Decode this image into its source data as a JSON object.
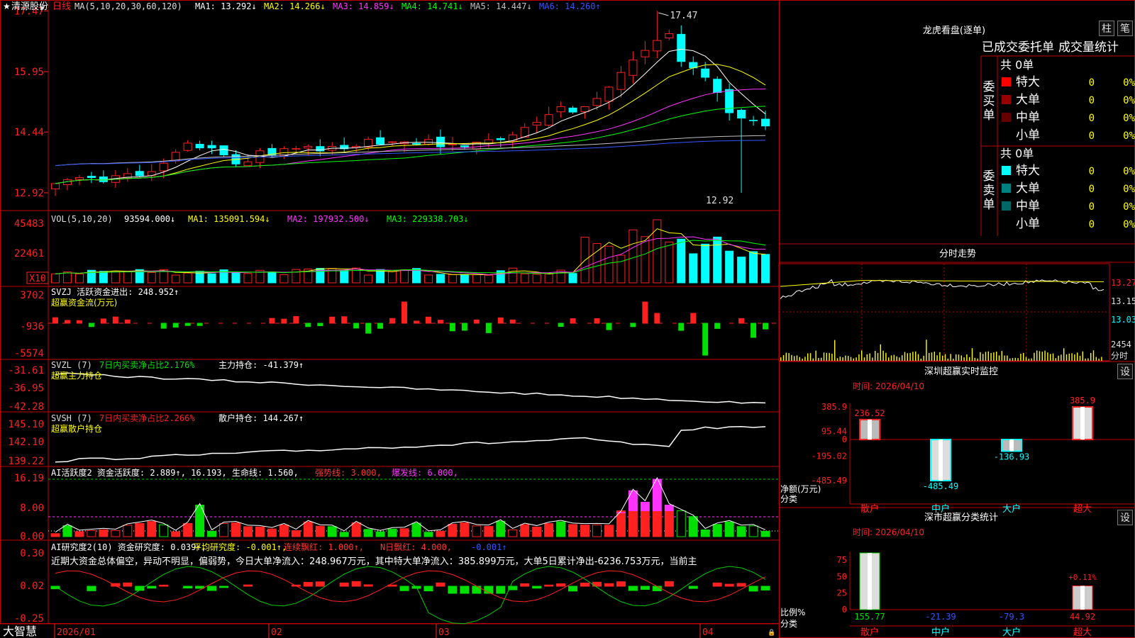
{
  "header": {
    "star": "★",
    "stock_name": "清源股份",
    "period": "日线",
    "ma_label": "MA(5,10,20,30,60,120)",
    "ma_values": [
      {
        "label": "MA1:",
        "value": "13.292",
        "arrow": "↓",
        "color": "#ffffff"
      },
      {
        "label": "MA2:",
        "value": "14.266",
        "arrow": "↓",
        "color": "#ffff00"
      },
      {
        "label": "MA3:",
        "value": "14.859",
        "arrow": "↓",
        "color": "#ff33ff"
      },
      {
        "label": "MA4:",
        "value": "14.741",
        "arrow": "↓",
        "color": "#00ff00"
      },
      {
        "label": "MA5:",
        "value": "14.447",
        "arrow": "↓",
        "color": "#c0c0c0"
      },
      {
        "label": "MA6:",
        "value": "14.260",
        "arrow": "↑",
        "color": "#3355ff"
      }
    ],
    "high_mark": "17.47",
    "low_mark": "12.92"
  },
  "price_axis": [
    "17.47",
    "15.95",
    "14.44",
    "12.92"
  ],
  "vol_panel": {
    "name": "VOL(5,10,20)",
    "value": "93594.000",
    "arrow": "↓",
    "ma": [
      {
        "label": "MA1:",
        "value": "135091.594",
        "arrow": "↓",
        "color": "#ffff00"
      },
      {
        "label": "MA2:",
        "value": "197932.500",
        "arrow": "↓",
        "color": "#ff33ff"
      },
      {
        "label": "MA3:",
        "value": "229338.703",
        "arrow": "↓",
        "color": "#00ff00"
      }
    ],
    "axis": [
      "45483",
      "22461"
    ],
    "unit": "X10"
  },
  "svzj_panel": {
    "name": "SVZJ",
    "label": "活跃资金进出:",
    "value": "248.952",
    "arrow": "↑",
    "sub": "超赢资金流(万元)",
    "axis": [
      "3702",
      "-936",
      "-5574"
    ]
  },
  "svzl_panel": {
    "name": "SVZL (7)",
    "label1": "7日内买卖净占比2.176%",
    "label2": "主力持仓:",
    "value": "-41.379",
    "arrow": "↑",
    "sub": "超赢主力持仓",
    "axis": [
      "-31.61",
      "-36.95",
      "-42.28"
    ]
  },
  "svsh_panel": {
    "name": "SVSH (7)",
    "label1": "7日内买卖净占比2.266%",
    "label2": "散户持仓:",
    "value": "144.267",
    "arrow": "↑",
    "sub": "超赢散户持仓",
    "axis": [
      "145.10",
      "142.10",
      "139.22"
    ]
  },
  "ai_active_panel": {
    "name": "AI活跃度2",
    "label": "资金活跃度:",
    "value": "2.889",
    "arrow": "↑",
    "v2": "16.193",
    "label3": "生命线:",
    "v3": "1.560",
    "label4": "强势线:",
    "v4": "3.000",
    "label5": "爆发线:",
    "v5": "6.000",
    "axis": [
      "16.19",
      "8.00",
      "0.00"
    ]
  },
  "ai_research_panel": {
    "name": "AI研究度2(10)",
    "label": "资金研究度:",
    "value": "0.039",
    "arrow": "↑",
    "label2": "平均研究度:",
    "v2": "-0.001",
    "label3": "连续飘红:",
    "v3": "1.000",
    "label4": "N日飘红:",
    "v4": "4.000",
    "v5": "-0.001",
    "comment": "近期大资金总体偏空，异动不明显，偏弱势，今日大单净流入：248.967万元，其中特大单净流入：385.899万元，大单5日累计净出-6236.753万元，当前主",
    "axis": [
      "0.30",
      "0.02",
      "-0.25"
    ]
  },
  "date_axis": [
    "2026/01",
    "02",
    "03",
    "04"
  ],
  "brand": "大智慧",
  "right": {
    "title": "龙虎看盘(逐单)",
    "btn1": "柱",
    "btn2": "笔",
    "tabs": [
      "已成交委托单",
      "成交量统计"
    ],
    "buy_label": "委买单",
    "sell_label": "委卖单",
    "buy_total": "共 0单",
    "sell_total": "共 0单",
    "buy_rows": [
      {
        "name": "特大",
        "count": "0",
        "pct": "0%",
        "color": "#ff0000"
      },
      {
        "name": "大单",
        "count": "0",
        "pct": "0%",
        "color": "#990000"
      },
      {
        "name": "中单",
        "count": "0",
        "pct": "0%",
        "color": "#660000"
      },
      {
        "name": "小单",
        "count": "0",
        "pct": "0%",
        "color": ""
      }
    ],
    "sell_rows": [
      {
        "name": "特大",
        "count": "0",
        "pct": "0%",
        "color": "#00ffff"
      },
      {
        "name": "大单",
        "count": "0",
        "pct": "0%",
        "color": "#008080"
      },
      {
        "name": "中单",
        "count": "0",
        "pct": "0%",
        "color": "#006666"
      },
      {
        "name": "小单",
        "count": "0",
        "pct": "0%",
        "color": ""
      }
    ],
    "intraday_title": "分时走势",
    "intraday_axis": [
      "13.27",
      "13.15",
      "13.03"
    ],
    "intraday_vol": [
      "2454",
      "分时"
    ],
    "monitor_title": "深圳超赢实时监控",
    "monitor_btn": "设",
    "monitor_time": "时间: 2026/04/10",
    "monitor_axis": [
      "385.9",
      "95.44",
      "0",
      "-195.02",
      "-485.49"
    ],
    "monitor_caption": [
      "净额(万元)",
      "分类"
    ],
    "classify_title": "深市超赢分类统计",
    "classify_btn": "设",
    "classify_time": "时间: 2026/04/10",
    "classify_axis": [
      "75",
      "50",
      "25",
      "0"
    ],
    "classify_caption": [
      "比例%",
      "分类"
    ]
  },
  "chart_data": [
    {
      "type": "bar",
      "title": "深圳超赢实时监控",
      "ylabel": "净额(万元)",
      "xlabel": "分类",
      "categories": [
        "散户",
        "中户",
        "大户",
        "超大"
      ],
      "values": [
        236.52,
        -485.49,
        -136.93,
        385.9
      ],
      "ylim": [
        -485.49,
        385.9
      ]
    },
    {
      "type": "bar",
      "title": "深市超赢分类统计",
      "ylabel": "比例%",
      "xlabel": "分类",
      "categories": [
        "散户",
        "中户",
        "大户",
        "超大"
      ],
      "values": [
        155.77,
        -21.39,
        -79.3,
        44.92
      ],
      "annotation": "+0.11%",
      "ylim": [
        0,
        75
      ]
    },
    {
      "type": "candlestick",
      "title": "清源股份 日线",
      "ylim": [
        12.92,
        17.47
      ],
      "x": [
        "2026/01",
        "02",
        "03",
        "04"
      ],
      "high": 17.47,
      "low": 12.92
    }
  ]
}
